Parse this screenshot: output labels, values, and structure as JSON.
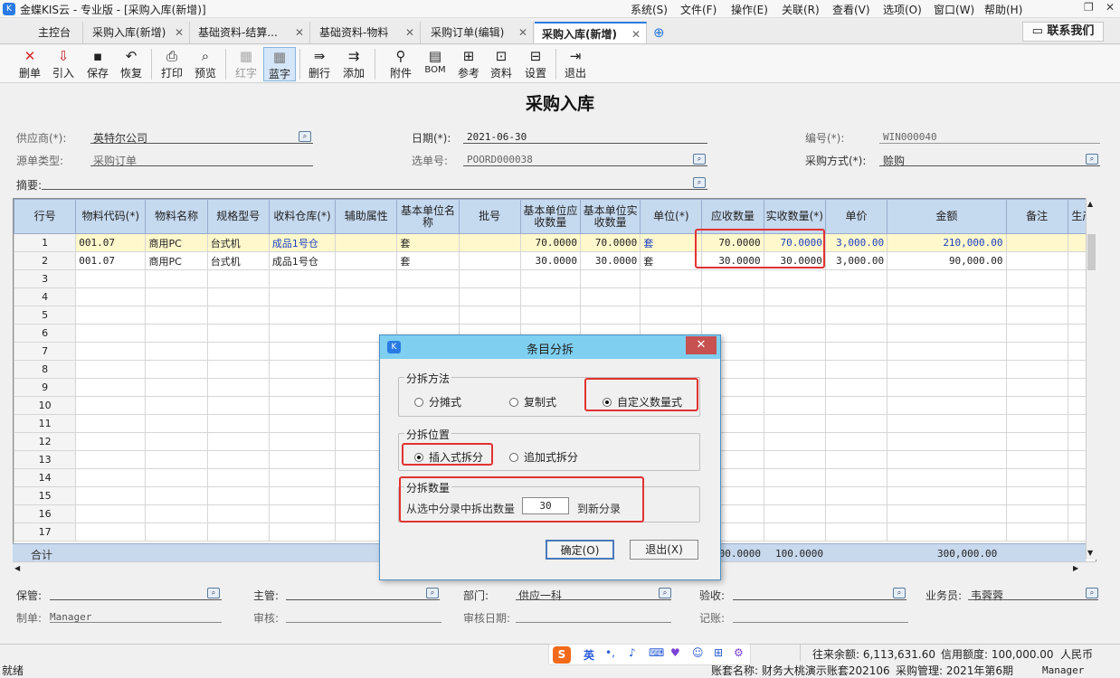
{
  "window": {
    "title": "金蝶KIS云 - 专业版 - [采购入库(新增)]",
    "menu": [
      "系统(S)",
      "文件(F)",
      "操作(E)",
      "关联(R)",
      "查看(V)",
      "选项(O)",
      "窗口(W)",
      "帮助(H)"
    ]
  },
  "tabs": [
    {
      "label": "主控台",
      "closable": false,
      "active": false
    },
    {
      "label": "采购入库(新增)",
      "closable": true,
      "active": false
    },
    {
      "label": "基础资料-结算...",
      "closable": true,
      "active": false
    },
    {
      "label": "基础资料-物料",
      "closable": true,
      "active": false
    },
    {
      "label": "采购订单(编辑)",
      "closable": true,
      "active": false
    },
    {
      "label": "采购入库(新增)",
      "closable": true,
      "active": true
    }
  ],
  "contact_button": "联系我们",
  "toolbar": {
    "buttons": [
      {
        "label": "删单",
        "icon": "delete-icon"
      },
      {
        "label": "引入",
        "icon": "import-icon"
      },
      {
        "label": "保存",
        "icon": "save-icon"
      },
      {
        "label": "恢复",
        "icon": "undo-icon"
      },
      {
        "label": "打印",
        "icon": "print-icon"
      },
      {
        "label": "预览",
        "icon": "preview-icon"
      },
      {
        "label": "红字",
        "icon": "red-word-icon"
      },
      {
        "label": "蓝字",
        "icon": "blue-word-icon"
      },
      {
        "label": "删行",
        "icon": "delete-row-icon"
      },
      {
        "label": "添加",
        "icon": "add-row-icon"
      },
      {
        "label": "附件",
        "icon": "attachment-icon"
      },
      {
        "label": "BOM",
        "icon": "bom-icon"
      },
      {
        "label": "参考",
        "icon": "reference-icon"
      },
      {
        "label": "资料",
        "icon": "data-icon"
      },
      {
        "label": "设置",
        "icon": "settings-icon"
      },
      {
        "label": "退出",
        "icon": "exit-icon"
      }
    ]
  },
  "form": {
    "title": "采购入库",
    "supplier_label": "供应商(*):",
    "supplier_value": "英特尔公司",
    "date_label": "日期(*):",
    "date_value": "2021-06-30",
    "number_label": "编号(*):",
    "number_value": "WIN000040",
    "source_type_label": "源单类型:",
    "source_type_value": "采购订单",
    "select_no_label": "选单号:",
    "select_no_value": "POORD000038",
    "purchase_method_label": "采购方式(*):",
    "purchase_method_value": "赊购",
    "summary_label": "摘要:"
  },
  "grid": {
    "headers": [
      "行号",
      "物料代码(*)",
      "物料名称",
      "规格型号",
      "收料仓库(*)",
      "辅助属性",
      "基本单位名称",
      "批号",
      "基本单位应收数量",
      "基本单位实收数量",
      "单位(*)",
      "应收数量",
      "实收数量(*)",
      "单价",
      "金额",
      "备注",
      "生产"
    ],
    "rows": [
      [
        "1",
        "001.07",
        "商用PC",
        "台式机",
        "成品1号仓",
        "",
        "套",
        "",
        "70.0000",
        "70.0000",
        "套",
        "70.0000",
        "70.0000",
        "3,000.00",
        "210,000.00",
        "",
        ""
      ],
      [
        "2",
        "001.07",
        "商用PC",
        "台式机",
        "成品1号仓",
        "",
        "套",
        "",
        "30.0000",
        "30.0000",
        "套",
        "30.0000",
        "30.0000",
        "3,000.00",
        "90,000.00",
        "",
        ""
      ]
    ],
    "empty_row_numbers": [
      "3",
      "4",
      "5",
      "6",
      "7",
      "8",
      "9",
      "10",
      "11",
      "12",
      "13",
      "14",
      "15",
      "16",
      "17"
    ],
    "total_label": "合计",
    "total_receivable_qty": "100.0000",
    "total_actual_qty": "100.0000",
    "total_amount": "300,000.00"
  },
  "dialog": {
    "title": "条目分拆",
    "method_group": "分拆方法",
    "method_options": [
      "分摊式",
      "复制式",
      "自定义数量式"
    ],
    "method_selected": "自定义数量式",
    "position_group": "分拆位置",
    "position_options": [
      "插入式拆分",
      "追加式拆分"
    ],
    "position_selected": "插入式拆分",
    "qty_group": "分拆数量",
    "qty_prefix": "从选中分录中拆出数量",
    "qty_value": "30",
    "qty_suffix": "到新分录",
    "ok_button": "确定(O)",
    "cancel_button": "退出(X)"
  },
  "footer": {
    "keeper_label": "保管:",
    "supervisor_label": "主管:",
    "dept_label": "部门:",
    "dept_value": "供应一科",
    "inspect_label": "验收:",
    "salesman_label": "业务员:",
    "salesman_value": "韦蓉蓉",
    "maker_label": "制单:",
    "maker_value": "Manager",
    "audit_label": "审核:",
    "audit_date_label": "审核日期:",
    "posting_label": "记账:"
  },
  "statusbar": {
    "ready": "就绪",
    "balance": "往来余额: 6,113,631.60",
    "credit": "信用额度: 100,000.00",
    "currency": "人民币",
    "account_set": "账套名称: 财务大桃演示账套202106",
    "period": "采购管理: 2021年第6期",
    "user": "Manager"
  },
  "ime": {
    "lang": "英"
  }
}
